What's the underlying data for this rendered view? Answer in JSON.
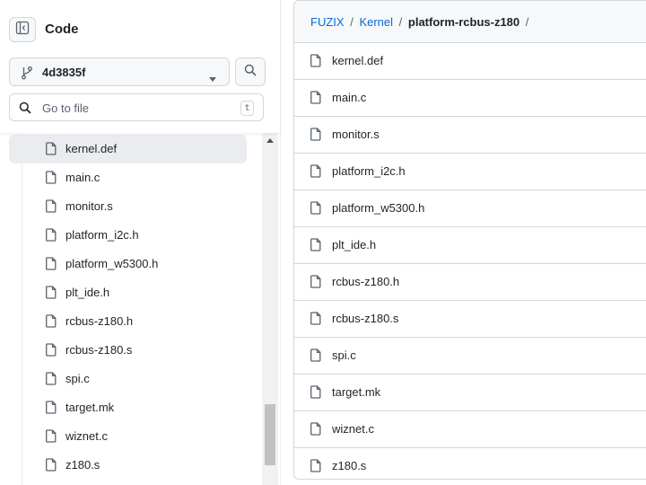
{
  "header": {
    "title": "Code",
    "branch": "4d3835f",
    "goto_placeholder": "Go to file",
    "goto_shortcut": "t"
  },
  "tree": {
    "items": [
      "kernel.def",
      "main.c",
      "monitor.s",
      "platform_i2c.h",
      "platform_w5300.h",
      "plt_ide.h",
      "rcbus-z180.h",
      "rcbus-z180.s",
      "spi.c",
      "target.mk",
      "wiznet.c",
      "z180.s"
    ],
    "active": "kernel.def"
  },
  "breadcrumb": {
    "repo": "FUZIX",
    "sep1": "/",
    "dir": "Kernel",
    "sep2": "/",
    "current": "platform-rcbus-z180",
    "sep3": "/"
  },
  "files": [
    "kernel.def",
    "main.c",
    "monitor.s",
    "platform_i2c.h",
    "platform_w5300.h",
    "plt_ide.h",
    "rcbus-z180.h",
    "rcbus-z180.s",
    "spi.c",
    "target.mk",
    "wiznet.c",
    "z180.s"
  ],
  "colors": {
    "link": "#0969da",
    "border": "#d0d7de",
    "active_row": "#eaecef",
    "text": "#1f2328"
  }
}
